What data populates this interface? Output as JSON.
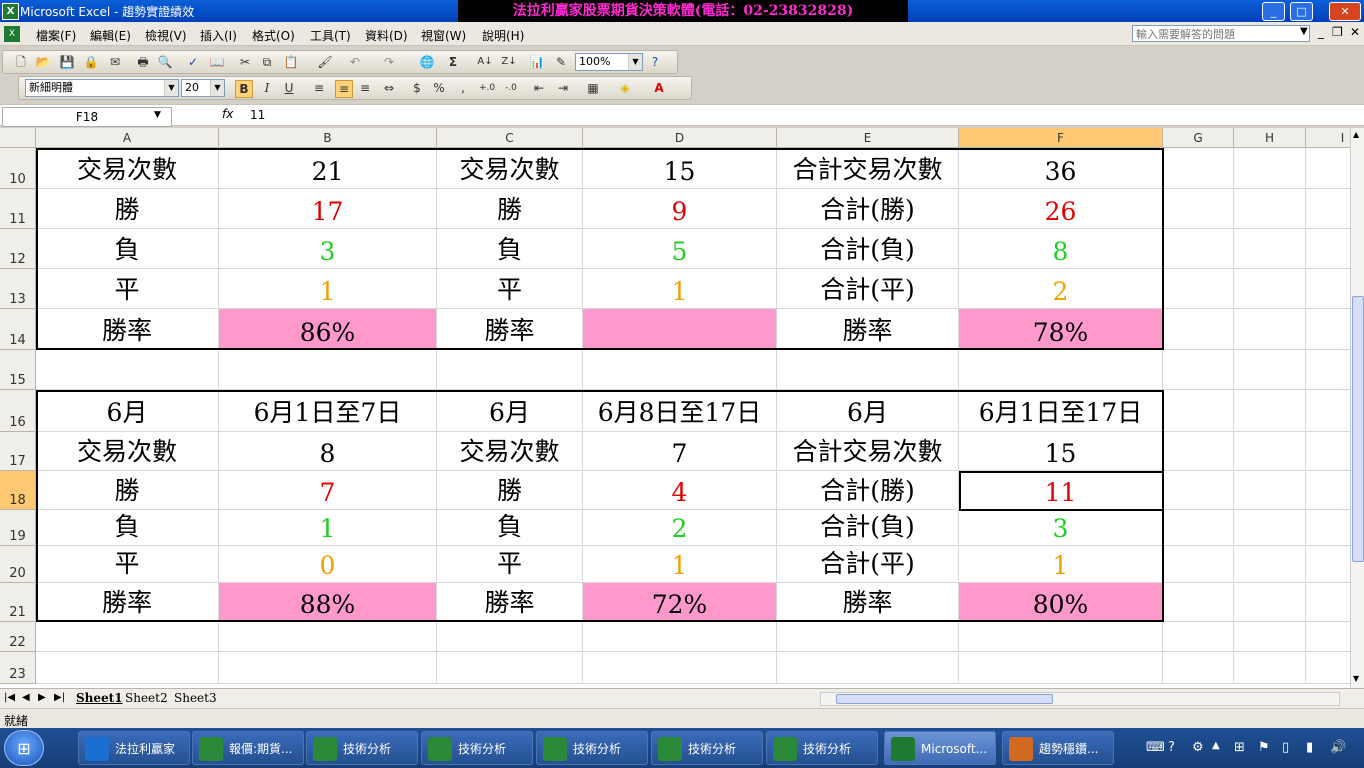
{
  "window": {
    "title": "Microsoft Excel - 趨勢實證績效",
    "banner": "法拉利贏家股票期貨決策軟體(電話：02-23832828)"
  },
  "menu": {
    "items": [
      "檔案(F)",
      "編輯(E)",
      "檢視(V)",
      "插入(I)",
      "格式(O)",
      "工具(T)",
      "資料(D)",
      "視窗(W)",
      "說明(H)"
    ],
    "help_placeholder": "輸入需要解答的問題"
  },
  "toolbar": {
    "zoom": "100%",
    "font_name": "新細明體",
    "font_size": "20",
    "bold": "B",
    "italic": "I",
    "underline": "U",
    "currency": "$",
    "percent": "%",
    "comma": ","
  },
  "formula": {
    "name_box": "F18",
    "fx": "fx",
    "value": "11"
  },
  "columns": [
    "A",
    "B",
    "C",
    "D",
    "E",
    "F",
    "G",
    "H",
    "I"
  ],
  "rows": [
    "10",
    "11",
    "12",
    "13",
    "14",
    "15",
    "16",
    "17",
    "18",
    "19",
    "20",
    "21",
    "22",
    "23"
  ],
  "cells": {
    "r10": [
      "交易次數",
      "21",
      "交易次數",
      "15",
      "合計交易次數",
      "36"
    ],
    "r11": [
      "勝",
      "17",
      "勝",
      "9",
      "合計(勝)",
      "26"
    ],
    "r12": [
      "負",
      "3",
      "負",
      "5",
      "合計(負)",
      "8"
    ],
    "r13": [
      "平",
      "1",
      "平",
      "1",
      "合計(平)",
      "2"
    ],
    "r14": [
      "勝率",
      "86%",
      "勝率",
      "",
      "勝率",
      "78%"
    ],
    "r16": [
      "6月",
      "6月1日至7日",
      "6月",
      "6月8日至17日",
      "6月",
      "6月1日至17日"
    ],
    "r17": [
      "交易次數",
      "8",
      "交易次數",
      "7",
      "合計交易次數",
      "15"
    ],
    "r18": [
      "勝",
      "7",
      "勝",
      "4",
      "合計(勝)",
      "11"
    ],
    "r19": [
      "負",
      "1",
      "負",
      "2",
      "合計(負)",
      "3"
    ],
    "r20": [
      "平",
      "0",
      "平",
      "1",
      "合計(平)",
      "1"
    ],
    "r21": [
      "勝率",
      "88%",
      "勝率",
      "72%",
      "勝率",
      "80%"
    ]
  },
  "sheets": [
    "Sheet1",
    "Sheet2",
    "Sheet3"
  ],
  "status": "就緒",
  "taskbar": {
    "items": [
      "法拉利贏家",
      "報價:期貨...",
      "技術分析",
      "技術分析",
      "技術分析",
      "技術分析",
      "技術分析",
      "Microsoft...",
      "趨勢穩鑽..."
    ]
  },
  "colors": {
    "win": "#e00000",
    "loss": "#20d020",
    "draw": "#f0a000",
    "rate_fill": "#ff99cc",
    "selected_header": "#ffc873"
  }
}
